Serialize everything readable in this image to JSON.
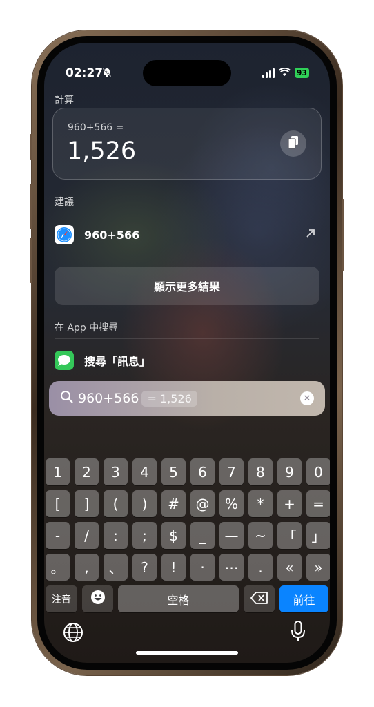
{
  "status": {
    "time": "02:27",
    "battery": "93"
  },
  "calculation": {
    "section_title": "計算",
    "expression": "960+566 =",
    "result": "1,526"
  },
  "suggestions": {
    "section_title": "建議",
    "item_label": "960+566",
    "show_more_label": "顯示更多結果"
  },
  "app_search": {
    "section_title": "在 App 中搜尋",
    "item_label": "搜尋「訊息」"
  },
  "search": {
    "query": "960+566",
    "inline_result": "= 1,526"
  },
  "keyboard": {
    "row1": [
      "1",
      "2",
      "3",
      "4",
      "5",
      "6",
      "7",
      "8",
      "9",
      "0"
    ],
    "row2": [
      "[",
      "]",
      "(",
      ")",
      "#",
      "@",
      "%",
      "*",
      "+",
      "="
    ],
    "row3": [
      "-",
      "/",
      ":",
      ";",
      "$",
      "_",
      "—",
      "~",
      "「",
      "」"
    ],
    "row4": [
      "。",
      ",",
      "、",
      "?",
      "!",
      "·",
      "⋯",
      ".",
      "«",
      "»"
    ],
    "zhuyin_label": "注音",
    "space_label": "空格",
    "go_label": "前往"
  },
  "colors": {
    "accent_blue": "#0a84ff",
    "battery_green": "#30d158"
  },
  "icons": [
    "bell-slash-icon",
    "cellular-signal-icon",
    "wifi-icon",
    "copy-icon",
    "safari-icon",
    "arrow-up-right-icon",
    "messages-icon",
    "search-icon",
    "clear-icon",
    "emoji-icon",
    "delete-icon",
    "globe-icon",
    "microphone-icon"
  ]
}
